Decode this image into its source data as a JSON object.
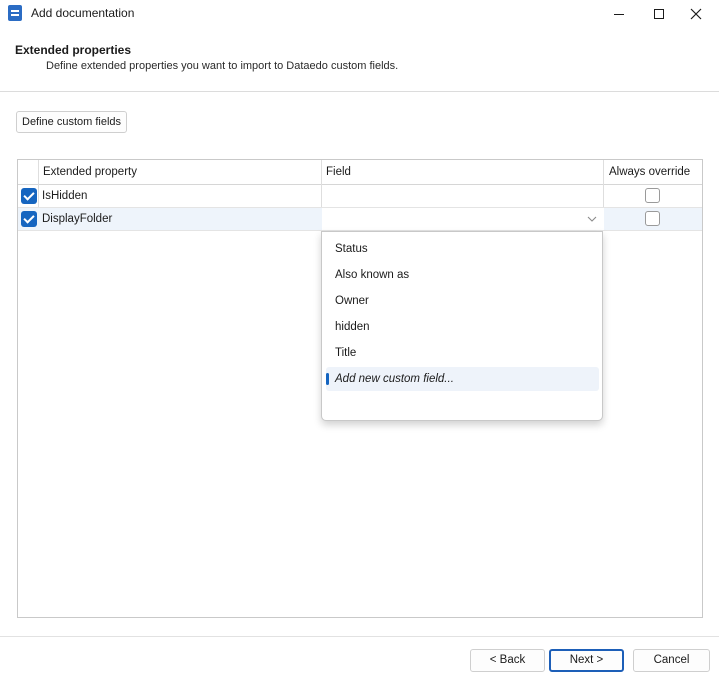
{
  "window": {
    "title": "Add documentation"
  },
  "header": {
    "title": "Extended properties",
    "subtitle": "Define extended properties you want to import to Dataedo custom fields."
  },
  "toolbar": {
    "define_custom_fields_label": "Define custom fields"
  },
  "grid": {
    "columns": [
      "Extended property",
      "Field",
      "Always override"
    ],
    "rows": [
      {
        "checked": true,
        "extended_property": "IsHidden",
        "field": "",
        "always_override": false
      },
      {
        "checked": true,
        "extended_property": "DisplayFolder",
        "field": "",
        "always_override": false,
        "selected": true
      }
    ]
  },
  "field_dropdown": {
    "open": true,
    "options": [
      "Status",
      "Also known as",
      "Owner",
      "hidden",
      "Title",
      "Add new custom field..."
    ],
    "highlighted_option": "Add new custom field..."
  },
  "footer": {
    "back_label": "< Back",
    "next_label": "Next >",
    "cancel_label": "Cancel"
  },
  "colors": {
    "accent": "#1565c0",
    "app_icon": "#2b6cc4"
  }
}
